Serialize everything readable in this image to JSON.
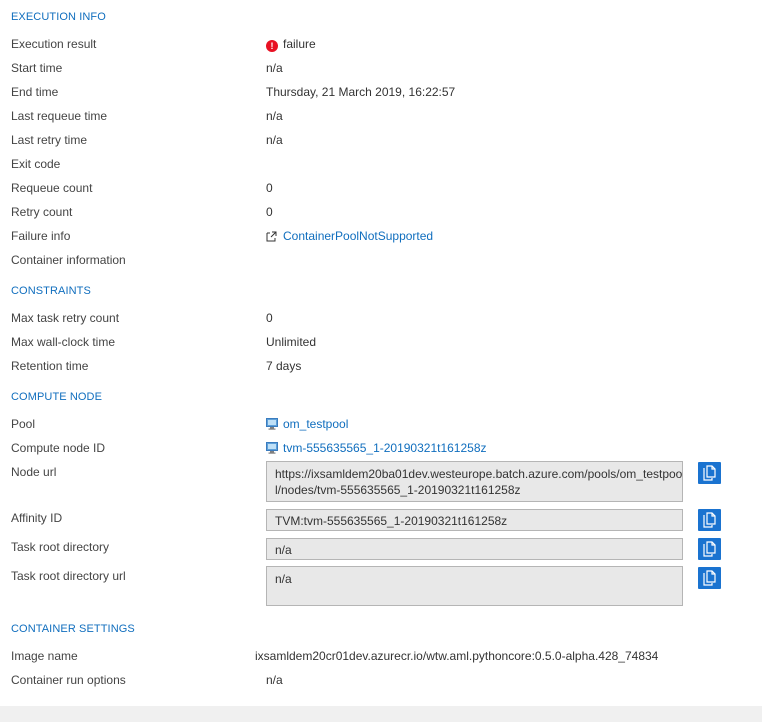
{
  "execution": {
    "title": "EXECUTION INFO",
    "result_label": "Execution result",
    "result_value": "failure",
    "start_label": "Start time",
    "start_value": "n/a",
    "end_label": "End time",
    "end_value": "Thursday, 21 March 2019, 16:22:57",
    "requeue_time_label": "Last requeue time",
    "requeue_time_value": "n/a",
    "retry_time_label": "Last retry time",
    "retry_time_value": "n/a",
    "exit_code_label": "Exit code",
    "requeue_count_label": "Requeue count",
    "requeue_count_value": "0",
    "retry_count_label": "Retry count",
    "retry_count_value": "0",
    "failure_label": "Failure info",
    "failure_value": "ContainerPoolNotSupported",
    "container_label": "Container information"
  },
  "constraints": {
    "title": "CONSTRAINTS",
    "max_retry_label": "Max task retry count",
    "max_retry_value": "0",
    "max_wall_label": "Max wall-clock time",
    "max_wall_value": "Unlimited",
    "retention_label": "Retention time",
    "retention_value": "7 days"
  },
  "compute": {
    "title": "COMPUTE NODE",
    "pool_label": "Pool",
    "pool_value": "om_testpool",
    "node_id_label": "Compute node ID",
    "node_id_value": "tvm-555635565_1-20190321t161258z",
    "node_url_label": "Node url",
    "node_url_line1": "https://ixsamldem20ba01dev.westeurope.batch.azure.com/pools/om_testpoo",
    "node_url_line2": "l/nodes/tvm-555635565_1-20190321t161258z",
    "affinity_label": "Affinity ID",
    "affinity_value": "TVM:tvm-555635565_1-20190321t161258z",
    "task_root_label": "Task root directory",
    "task_root_value": "n/a",
    "task_root_url_label": "Task root directory url",
    "task_root_url_value": "n/a"
  },
  "container": {
    "title": "CONTAINER SETTINGS",
    "image_label": "Image name",
    "image_value": "ixsamldem20cr01dev.azurecr.io/wtw.aml.pythoncore:0.5.0-alpha.428_74834",
    "run_options_label": "Container run options",
    "run_options_value": "n/a"
  },
  "icons": {
    "error": "error-circle-icon",
    "external": "external-link-icon",
    "pool": "computer-icon",
    "copy": "copy-icon"
  },
  "colors": {
    "accent": "#106ebe",
    "error": "#e81123",
    "copy_button": "#1a73d0"
  }
}
